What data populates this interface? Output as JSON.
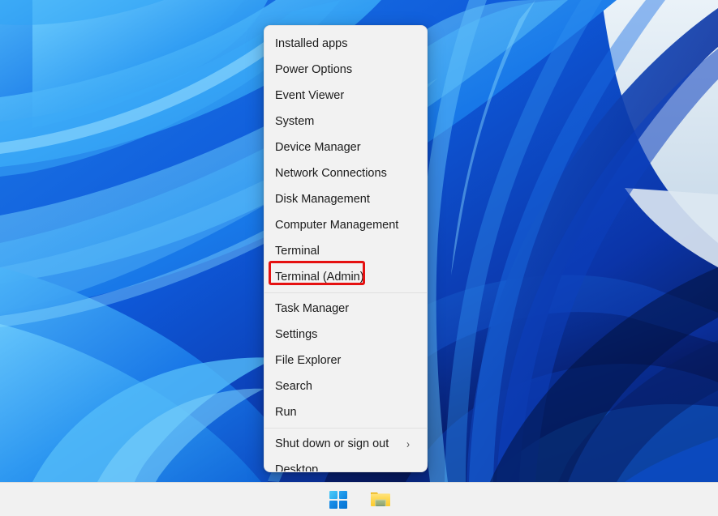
{
  "desktop": {
    "wallpaper_name": "windows-11-bloom-wallpaper",
    "colors": {
      "deep_navy": "#071a5a",
      "royal_blue": "#0b48d0",
      "mid_blue": "#1570e8",
      "bright_blue": "#2f9cf4",
      "light_cyan": "#63c3fb",
      "pale_sky": "#d7e3ee"
    }
  },
  "winx_menu": {
    "name": "win-x-quick-link-menu",
    "items": [
      {
        "label": "Installed apps",
        "type": "item"
      },
      {
        "label": "Power Options",
        "type": "item"
      },
      {
        "label": "Event Viewer",
        "type": "item"
      },
      {
        "label": "System",
        "type": "item"
      },
      {
        "label": "Device Manager",
        "type": "item"
      },
      {
        "label": "Network Connections",
        "type": "item"
      },
      {
        "label": "Disk Management",
        "type": "item"
      },
      {
        "label": "Computer Management",
        "type": "item"
      },
      {
        "label": "Terminal",
        "type": "item"
      },
      {
        "label": "Terminal (Admin)",
        "type": "item",
        "highlighted": true
      },
      {
        "label": "",
        "type": "separator"
      },
      {
        "label": "Task Manager",
        "type": "item"
      },
      {
        "label": "Settings",
        "type": "item"
      },
      {
        "label": "File Explorer",
        "type": "item"
      },
      {
        "label": "Search",
        "type": "item"
      },
      {
        "label": "Run",
        "type": "item"
      },
      {
        "label": "",
        "type": "separator"
      },
      {
        "label": "Shut down or sign out",
        "type": "submenu",
        "arrow": "›"
      },
      {
        "label": "Desktop",
        "type": "item"
      }
    ]
  },
  "annotation": {
    "target_label": "Terminal (Admin)",
    "color": "#e51111"
  },
  "taskbar": {
    "buttons": [
      {
        "name": "start-button",
        "icon": "windows-logo-icon",
        "label": "Start"
      },
      {
        "name": "file-explorer-button",
        "icon": "folder-icon",
        "label": "File Explorer"
      }
    ]
  }
}
